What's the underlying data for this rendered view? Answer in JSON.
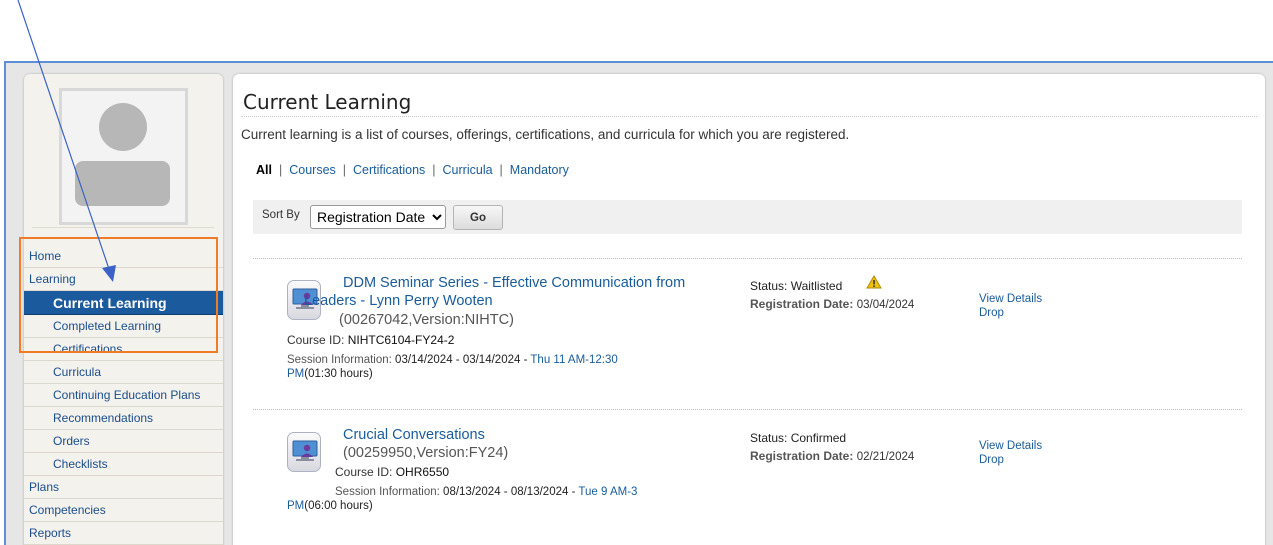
{
  "sidebar": {
    "items": [
      {
        "label": "Home",
        "level": 1,
        "active": false
      },
      {
        "label": "Learning",
        "level": 1,
        "active": false
      },
      {
        "label": "Current Learning",
        "level": 2,
        "active": true
      },
      {
        "label": "Completed Learning",
        "level": 2,
        "active": false
      },
      {
        "label": "Certifications",
        "level": 2,
        "active": false
      },
      {
        "label": "Curricula",
        "level": 2,
        "active": false
      },
      {
        "label": "Continuing Education Plans",
        "level": 2,
        "active": false
      },
      {
        "label": "Recommendations",
        "level": 2,
        "active": false
      },
      {
        "label": "Orders",
        "level": 2,
        "active": false
      },
      {
        "label": "Checklists",
        "level": 2,
        "active": false
      },
      {
        "label": "Plans",
        "level": 1,
        "active": false
      },
      {
        "label": "Competencies",
        "level": 1,
        "active": false
      },
      {
        "label": "Reports",
        "level": 1,
        "active": false
      }
    ]
  },
  "main": {
    "title": "Current Learning",
    "description": "Current learning is a list of courses, offerings, certifications, and curricula for which you are registered.",
    "filters": [
      "All",
      "Courses",
      "Certifications",
      "Curricula",
      "Mandatory"
    ],
    "active_filter": "All",
    "sort": {
      "label": "Sort By",
      "selected": "Registration Date",
      "go_label": "Go"
    }
  },
  "courses": [
    {
      "title": "DDM Seminar Series - Effective Communication from Leaders - Lynn Perry Wooten",
      "id_version": "(00267042,Version:NIHTC)",
      "course_id_label": "Course ID:",
      "course_id": "NIHTC6104-FY24-2",
      "session_label": "Session Information:",
      "session_dates": "03/14/2024 - 03/14/2024 -",
      "session_time": "Thu 11 AM-12:30 PM",
      "session_duration": "(01:30 hours)",
      "status": "Status: Waitlisted",
      "status_warning": true,
      "reg_label": "Registration Date:",
      "reg_date": "03/04/2024",
      "view_details": "View Details",
      "drop": "Drop"
    },
    {
      "title": "Crucial Conversations",
      "id_version": "(00259950,Version:FY24)",
      "course_id_label": "Course ID:",
      "course_id": "OHR6550",
      "session_label": "Session Information:",
      "session_dates": "08/13/2024 - 08/13/2024 -",
      "session_time": "Tue 9 AM-3 PM",
      "session_duration": "(06:00 hours)",
      "status": "Status: Confirmed",
      "status_warning": false,
      "reg_label": "Registration Date:",
      "reg_date": "02/21/2024",
      "view_details": "View Details",
      "drop": "Drop"
    }
  ],
  "colors": {
    "link": "#1a5c9a",
    "active_nav": "#1b5a9c",
    "annotation": "#ef7d28",
    "frame_border": "#5b8fd6",
    "warning": "#f2c10f"
  }
}
